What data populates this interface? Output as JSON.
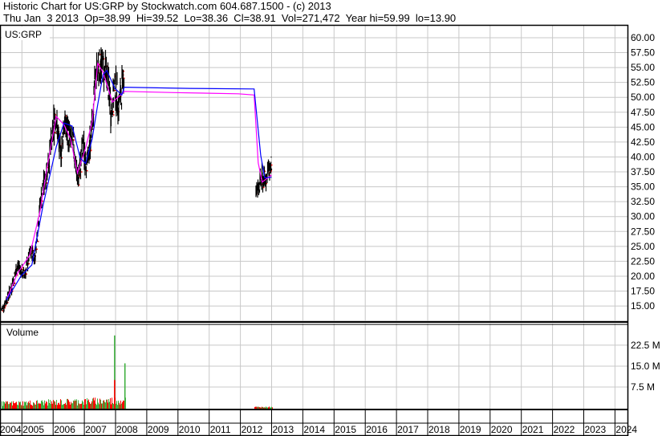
{
  "header": {
    "title": "Historic Chart for US:GRP by Stockwatch.com 604.687.1500 - (c) 2013",
    "quote": "Thu Jan  3 2013  Op=38.99  Hi=39.52  Lo=38.36  Cl=38.91  Vol=271,472  Year hi=59.99  lo=13.90"
  },
  "colors": {
    "price": "#000000",
    "close_tick": "#ff0000",
    "ma_fast": "#ff00ff",
    "ma_slow": "#0000ff",
    "vol_up": "#40b040",
    "vol_down": "#ff0000",
    "grid": "#c8c8c8"
  },
  "chart_data": {
    "type": "line",
    "symbol_label": "US:GRP",
    "volume_label": "Volume",
    "price_ticks": [
      "60.00",
      "57.50",
      "55.00",
      "52.50",
      "50.00",
      "47.50",
      "45.00",
      "42.50",
      "40.00",
      "37.50",
      "35.00",
      "32.50",
      "30.00",
      "27.50",
      "25.00",
      "22.50",
      "20.00",
      "17.50",
      "15.00"
    ],
    "price_ylim": [
      12.5,
      62.5
    ],
    "volume_ticks": [
      {
        "v": 22.5,
        "label": "22.5 M"
      },
      {
        "v": 15.0,
        "label": "15.0 M"
      },
      {
        "v": 7.5,
        "label": "7.5 M"
      }
    ],
    "x_ticks": [
      "2004",
      "2005",
      "2006",
      "2007",
      "2008",
      "2009",
      "2010",
      "2011",
      "2012",
      "2013",
      "2014",
      "2015",
      "2016",
      "2017",
      "2018",
      "2019",
      "2020",
      "2021",
      "2022",
      "2023",
      "2024"
    ],
    "price_segments": [
      [
        [
          2004.34,
          14.2
        ],
        [
          2004.64,
          17.8
        ],
        [
          2004.86,
          21.9
        ],
        [
          2005.07,
          20.1
        ],
        [
          2005.28,
          24.2
        ],
        [
          2005.41,
          23.2
        ],
        [
          2005.58,
          32.3
        ],
        [
          2005.76,
          37.1
        ],
        [
          2005.97,
          43.0
        ],
        [
          2006.05,
          47.5
        ],
        [
          2006.23,
          40.3
        ],
        [
          2006.35,
          45.7
        ],
        [
          2006.48,
          43.8
        ],
        [
          2006.66,
          41.7
        ],
        [
          2006.78,
          35.8
        ],
        [
          2006.96,
          41.7
        ],
        [
          2007.08,
          38.5
        ],
        [
          2007.25,
          45.7
        ],
        [
          2007.38,
          55.2
        ],
        [
          2007.55,
          55.2
        ],
        [
          2007.72,
          53.8
        ],
        [
          2007.85,
          47.5
        ],
        [
          2007.98,
          51.9
        ],
        [
          2008.11,
          48.8
        ],
        [
          2008.28,
          54.2
        ]
      ],
      [
        [
          2012.48,
          34.0
        ],
        [
          2012.65,
          35.8
        ],
        [
          2012.82,
          36.7
        ],
        [
          2013.01,
          38.9
        ]
      ]
    ],
    "ma_slow": [
      [
        2004.5,
        16
      ],
      [
        2004.98,
        20.1
      ],
      [
        2005.32,
        21.9
      ],
      [
        2005.67,
        31.7
      ],
      [
        2006.1,
        41.7
      ],
      [
        2006.35,
        45.7
      ],
      [
        2006.61,
        45.2
      ],
      [
        2006.87,
        39.8
      ],
      [
        2007.04,
        38.9
      ],
      [
        2007.25,
        43
      ],
      [
        2007.43,
        48.8
      ],
      [
        2007.6,
        53.8
      ],
      [
        2007.72,
        54.5
      ],
      [
        2007.98,
        51.5
      ],
      [
        2008.2,
        50.4
      ],
      [
        2008.28,
        51.7
      ],
      [
        2010.38,
        51.5
      ],
      [
        2012.44,
        51.4
      ],
      [
        2012.65,
        40.3
      ],
      [
        2012.78,
        36.5
      ],
      [
        2013.0,
        36.6
      ]
    ],
    "ma_fast": [
      [
        2004.5,
        16
      ],
      [
        2004.86,
        20.5
      ],
      [
        2005.25,
        23.5
      ],
      [
        2005.58,
        30.9
      ],
      [
        2005.8,
        38
      ],
      [
        2006.1,
        46.8
      ],
      [
        2006.35,
        45.4
      ],
      [
        2006.56,
        43
      ],
      [
        2006.78,
        37.3
      ],
      [
        2007.04,
        41.5
      ],
      [
        2007.25,
        45.9
      ],
      [
        2007.43,
        55.7
      ],
      [
        2007.6,
        54.2
      ],
      [
        2007.9,
        49.2
      ],
      [
        2008.14,
        50.3
      ],
      [
        2008.28,
        51
      ],
      [
        2009.87,
        50.8
      ],
      [
        2011.93,
        50.6
      ],
      [
        2012.44,
        50.4
      ],
      [
        2012.57,
        39
      ],
      [
        2012.7,
        35.8
      ],
      [
        2013.0,
        37
      ]
    ],
    "volume_M": {
      "ranges": [
        [
          2004.34,
          2008.3
        ],
        [
          2012.45,
          2013.0
        ]
      ],
      "typical_M": [
        1.5,
        0.3
      ],
      "spikes": [
        {
          "x": 2007.95,
          "up": 26.0,
          "down": 10.0
        },
        {
          "x": 2008.28,
          "up": 16.0,
          "down": 0
        }
      ]
    }
  }
}
